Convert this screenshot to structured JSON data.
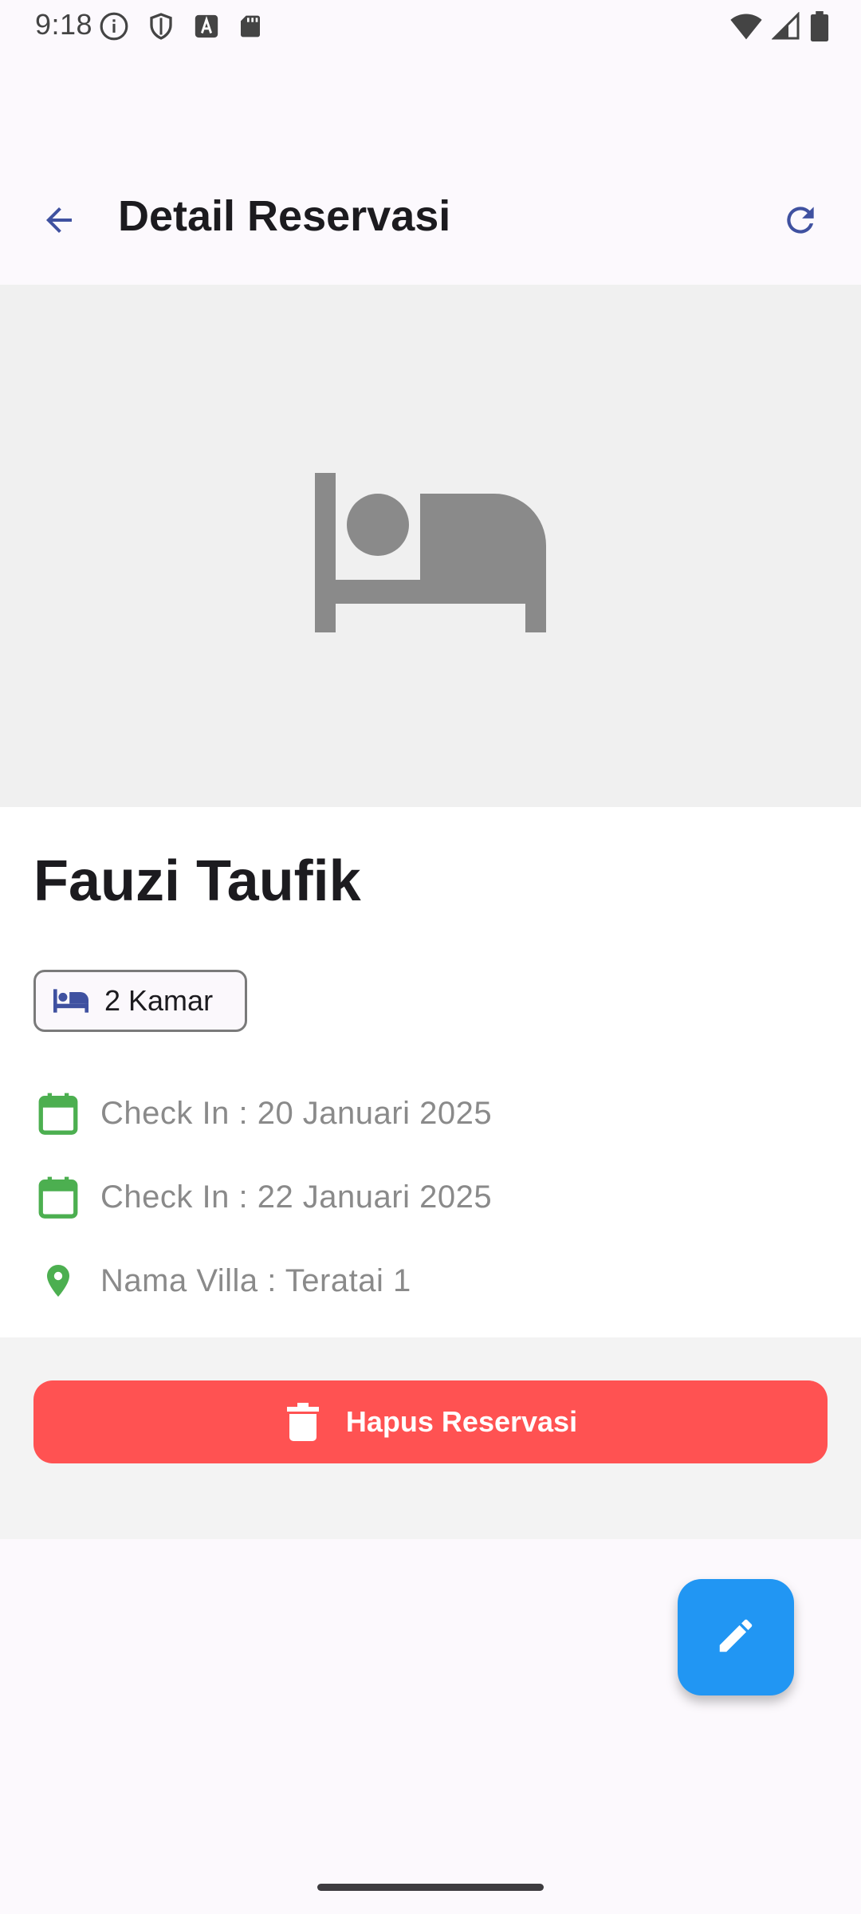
{
  "status_bar": {
    "time": "9:18",
    "left_icons": [
      "info-icon",
      "shield-icon",
      "font-icon",
      "sd-card-icon"
    ],
    "right_icons": [
      "wifi-icon",
      "signal-icon",
      "battery-icon"
    ]
  },
  "app_bar": {
    "title": "Detail Reservasi",
    "back_icon": "arrow-back-icon",
    "refresh_icon": "refresh-icon"
  },
  "hero": {
    "icon": "bed-icon",
    "background": "#f0f0f0",
    "icon_color": "#8a8a8a"
  },
  "reservation": {
    "guest_name": "Fauzi Taufik",
    "room_chip": "2 Kamar",
    "check_in": "Check In : 20 Januari 2025",
    "check_out": "Check In : 22 Januari 2025",
    "villa": "Nama Villa : Teratai 1"
  },
  "actions": {
    "delete_label": "Hapus Reservasi",
    "delete_color": "#ff5252",
    "edit_icon": "pencil-icon",
    "fab_color": "#2196f3"
  },
  "colors": {
    "accent": "#3f51b5",
    "success": "#4caf50",
    "muted_text": "#8a8a8a"
  }
}
